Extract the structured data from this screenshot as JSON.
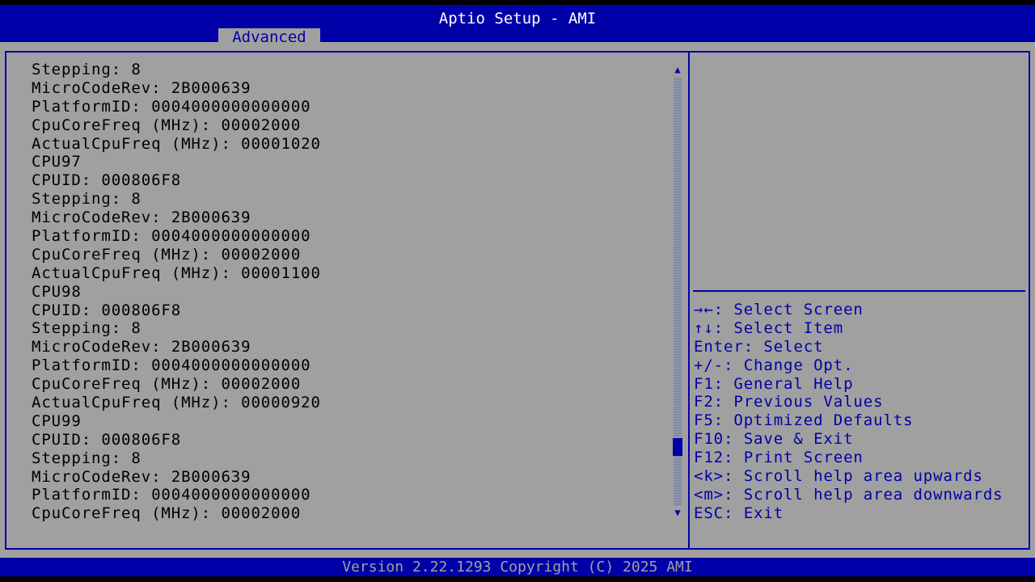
{
  "header": {
    "title": "Aptio Setup - AMI",
    "tab": "Advanced"
  },
  "main": {
    "lines": [
      "Stepping: 8",
      "MicroCodeRev: 2B000639",
      "PlatformID: 0004000000000000",
      "CpuCoreFreq (MHz): 00002000",
      "ActualCpuFreq (MHz): 00001020",
      "CPU97",
      "CPUID: 000806F8",
      "Stepping: 8",
      "MicroCodeRev: 2B000639",
      "PlatformID: 0004000000000000",
      "CpuCoreFreq (MHz): 00002000",
      "ActualCpuFreq (MHz): 00001100",
      "CPU98",
      "CPUID: 000806F8",
      "Stepping: 8",
      "MicroCodeRev: 2B000639",
      "PlatformID: 0004000000000000",
      "CpuCoreFreq (MHz): 00002000",
      "ActualCpuFreq (MHz): 00000920",
      "CPU99",
      "CPUID: 000806F8",
      "Stepping: 8",
      "MicroCodeRev: 2B000639",
      "PlatformID: 0004000000000000",
      "CpuCoreFreq (MHz): 00002000"
    ],
    "scroll_position": 0.88
  },
  "help": {
    "lines": [
      "→←: Select Screen",
      "↑↓: Select Item",
      "Enter: Select",
      "+/-: Change Opt.",
      "F1: General Help",
      "F2: Previous Values",
      "F5: Optimized Defaults",
      "F10: Save & Exit",
      "F12: Print Screen",
      "<k>: Scroll help area upwards",
      "<m>: Scroll help area downwards",
      "ESC: Exit"
    ]
  },
  "footer": {
    "text": "Version 2.22.1293 Copyright (C) 2025 AMI"
  }
}
